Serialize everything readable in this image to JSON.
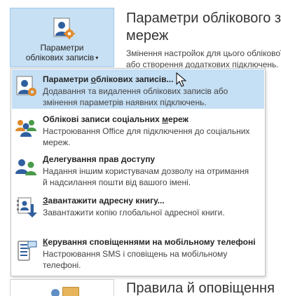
{
  "account_tile": {
    "label_line1": "Параметри",
    "label_line2": "облікових записів",
    "caret": "▾"
  },
  "right_panel": {
    "title_line1": "Параметри облікового за",
    "title_line2": "мереж",
    "desc_line1": "Змінення настройок для цього облікової",
    "desc_line2": "або створення додаткових підключень.",
    "rules_title": "Правила й оповіщення"
  },
  "menu": {
    "items": [
      {
        "title_pre": "Параметри ",
        "title_u": "о",
        "title_post": "блікових записів...",
        "desc": "Додавання та видалення облікових записів або змінення параметрів наявних підключень.",
        "icon": "account-settings-icon",
        "active": true
      },
      {
        "title_pre": "Облікові записи соціальних ",
        "title_u": "м",
        "title_post": "ереж",
        "desc": "Настроювання Office для підключення до соціальних мереж.",
        "icon": "social-networks-icon",
        "active": false
      },
      {
        "title_pre": "",
        "title_u": "Д",
        "title_post": "елегування прав доступу",
        "desc": "Надання іншим користувачам дозволу на отримання й надсилання пошти від вашого імені.",
        "icon": "delegate-access-icon",
        "active": false
      },
      {
        "title_pre": "",
        "title_u": "З",
        "title_post": "авантажити адресну книгу...",
        "desc": "Завантажити копію глобальної адресної книги.",
        "icon": "download-address-book-icon",
        "active": false
      },
      {
        "title_pre": "",
        "title_u": "К",
        "title_post": "ерування сповіщеннями на мобільному телефоні",
        "desc": "Настроювання SMS і сповіщень на мобільному телефоні.",
        "icon": "mobile-alerts-icon",
        "active": false
      }
    ]
  },
  "colors": {
    "tile_bg": "#c7e0f4",
    "active_item_bg": "#c5dff4",
    "icon_blue": "#3a6fb4",
    "icon_orange": "#e08a2c"
  }
}
